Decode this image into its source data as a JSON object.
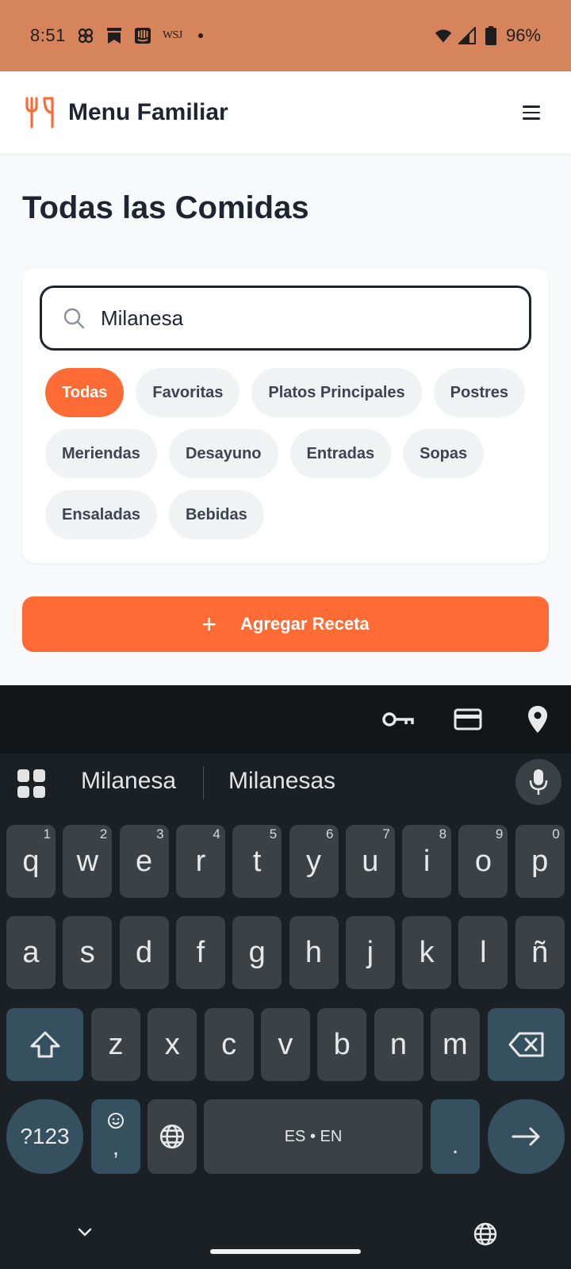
{
  "status_bar": {
    "time": "8:51",
    "wsj": "WSJ",
    "battery": "96%",
    "icons": [
      "pinwheel-icon",
      "bookmark-icon",
      "intercom-icon",
      "wifi-icon",
      "signal-icon",
      "battery-icon"
    ]
  },
  "app": {
    "name": "Menu Familiar",
    "accent": "#ff6b35",
    "status_bar_color": "#d6845c"
  },
  "page": {
    "title": "Todas las Comidas"
  },
  "search": {
    "value": "Milanesa"
  },
  "filters": [
    {
      "label": "Todas",
      "active": true
    },
    {
      "label": "Favoritas",
      "active": false
    },
    {
      "label": "Platos Principales",
      "active": false
    },
    {
      "label": "Postres",
      "active": false
    },
    {
      "label": "Meriendas",
      "active": false
    },
    {
      "label": "Desayuno",
      "active": false
    },
    {
      "label": "Entradas",
      "active": false
    },
    {
      "label": "Sopas",
      "active": false
    },
    {
      "label": "Ensaladas",
      "active": false
    },
    {
      "label": "Bebidas",
      "active": false
    }
  ],
  "add_button": {
    "plus": "+",
    "label": "Agregar Receta"
  },
  "keyboard": {
    "suggestions": [
      "Milanesa",
      "Milanesas"
    ],
    "row1": [
      {
        "k": "q",
        "h": "1"
      },
      {
        "k": "w",
        "h": "2"
      },
      {
        "k": "e",
        "h": "3"
      },
      {
        "k": "r",
        "h": "4"
      },
      {
        "k": "t",
        "h": "5"
      },
      {
        "k": "y",
        "h": "6"
      },
      {
        "k": "u",
        "h": "7"
      },
      {
        "k": "i",
        "h": "8"
      },
      {
        "k": "o",
        "h": "9"
      },
      {
        "k": "p",
        "h": "0"
      }
    ],
    "row2": [
      "a",
      "s",
      "d",
      "f",
      "g",
      "h",
      "j",
      "k",
      "l",
      "ñ"
    ],
    "row3": [
      "z",
      "x",
      "c",
      "v",
      "b",
      "n",
      "m"
    ],
    "symbols_key": "?123",
    "comma_key": ",",
    "space_label": "ES • EN",
    "period_key": "."
  }
}
